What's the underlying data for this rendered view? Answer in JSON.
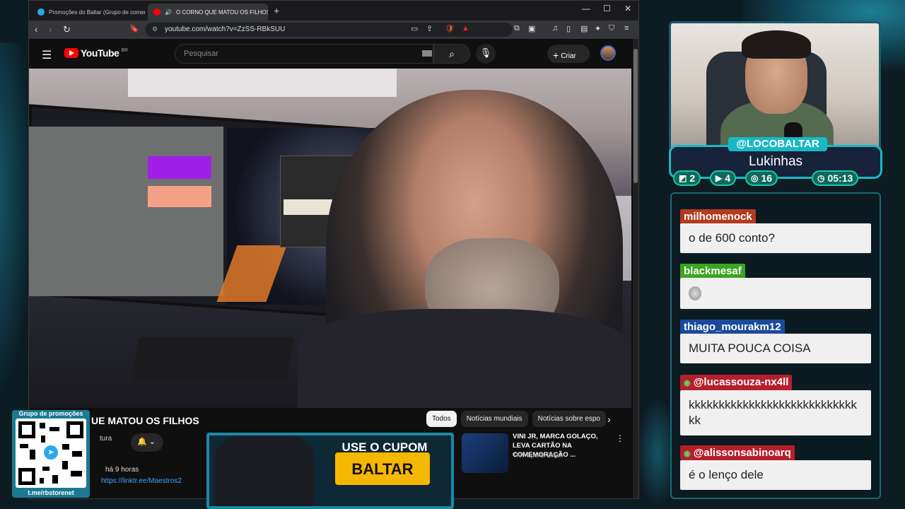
{
  "browser": {
    "tabs": [
      {
        "title": "Promoções do Baltar (Grupo de comentários)"
      },
      {
        "title": "O CORNO QUE MATOU OS FILHOS"
      }
    ],
    "url": "youtube.com/watch?v=ZzSS-RBkSUU"
  },
  "youtube": {
    "logo_text": "YouTube",
    "region": "BR",
    "search_placeholder": "Pesquisar",
    "create_label": "Criar",
    "video_title_fragment": "UE MATOU OS FILHOS",
    "channel_fragment": "tura",
    "date": "há 9 horas",
    "link_text": "https://linktr.ee/Maestros2",
    "chips": [
      "Todos",
      "Notícias mundiais",
      "Notícias sobre espo"
    ],
    "recommended": {
      "title": "VINI JR, MARCA GOLAÇO, LEVA CARTÃO NA COMEMORAÇÃO ...",
      "channel": "TNT Sports Brasil"
    }
  },
  "stream": {
    "handle": "@LOCOBALTAR",
    "display_name": "Lukinhas",
    "stats": [
      {
        "icon": "twitch-icon",
        "value": "2"
      },
      {
        "icon": "youtube-icon",
        "value": "4"
      },
      {
        "icon": "kick-icon",
        "value": "16"
      },
      {
        "icon": "clock-icon",
        "value": "05:13"
      }
    ]
  },
  "chat": {
    "messages": [
      {
        "user": "milhomenock",
        "color": "#b53a1f",
        "text": "o de 600 conto?"
      },
      {
        "user": "blackmesaf",
        "color": "#3aa51e",
        "text": ""
      },
      {
        "user": "thiago_mourakm12",
        "color": "#1b4a9c",
        "text": "MUITA POUCA COISA"
      },
      {
        "user": "@lucassouza-nx4ll",
        "color": "#b51f2c",
        "text": "kkkkkkkkkkkkkkkkkkkkkkkkkkkkkk"
      },
      {
        "user": "@alissonsabinoarq",
        "color": "#b51f2c",
        "text": "é o lenço dele"
      }
    ]
  },
  "promo": {
    "qr_label": "Grupo de promoções",
    "qr_url": "t.me/rbstorenet",
    "coupon_text": "USE O CUPOM",
    "coupon_code": "BALTAR"
  }
}
